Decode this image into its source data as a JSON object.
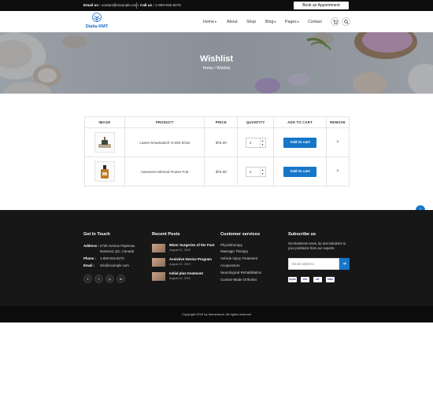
{
  "topbar": {
    "email_label": "Email us :",
    "email_value": "contact@example.com",
    "call_label": "Call us :",
    "call_value": "1-800-915-6270",
    "appointment_button": "Book an Appointment"
  },
  "header": {
    "logo_text": "Dialia RMT",
    "nav": {
      "home": "Home",
      "about": "About",
      "shop": "Shop",
      "blog": "Blog",
      "pages": "Pages",
      "contact": "Contact"
    },
    "icons": {
      "cart": "cart-icon",
      "search": "search-icon",
      "dropdown": "chevron-down-icon"
    }
  },
  "hero": {
    "title": "Wishlist",
    "breadcrumb_home": "Home",
    "breadcrumb_sep": "/",
    "breadcrumb_current": "Wishlist"
  },
  "wishlist": {
    "headers": [
      "IMAGE",
      "PRODUCT",
      "PRICE",
      "QUANTITY",
      "ADD TO CART",
      "REMOVE"
    ],
    "rows": [
      {
        "product": "Latest Smartwatch H-250-2018",
        "price": "$75.00",
        "quantity": "1",
        "add_to_cart": "Add to cart",
        "remove": "×"
      },
      {
        "product": "Awesome Mineral Flower Fub",
        "price": "$75.00",
        "quantity": "1",
        "add_to_cart": "Add to cart",
        "remove": "×"
      }
    ]
  },
  "footer": {
    "get_in_touch": {
      "heading": "Get In Touch",
      "address_label": "Address :",
      "address_line1": "2726 Avenue Papineau",
      "address_line2": "Montreal, QC, Canada",
      "phone_label": "Phone :",
      "phone_value": "1-800-915-6270",
      "email_label": "Email :",
      "email_value": "info@example.com",
      "social": [
        "twitter-icon",
        "facebook-icon",
        "pinterest-icon",
        "linkedin-icon"
      ]
    },
    "recent_posts": {
      "heading": "Recent Posts",
      "posts": [
        {
          "title": "Minor Surgeries of the Foot",
          "date": "August 01, 2019"
        },
        {
          "title": "Assistive Device Program",
          "date": "August 01, 2019"
        },
        {
          "title": "Initial plus treatment",
          "date": "August 01, 2019"
        }
      ]
    },
    "services": {
      "heading": "Customer services",
      "items": [
        "Physiotherapy",
        "Massage Therapy",
        "Vehicle Injury Treatment",
        "Acupuncture",
        "Neurological Rehabilitation",
        "Custom-Made Orthotics"
      ]
    },
    "subscribe": {
      "heading": "Subscribe us",
      "text": "Get Business news, tip and solutions to your problems from our experts.",
      "email_placeholder": "Email address",
      "payments": [
        "PayPal",
        "VISA",
        "MC",
        "AMEX"
      ]
    },
    "copyright": "Copyright 2019 by themerarch. All rights reserved"
  },
  "colors": {
    "accent": "#1676c8",
    "footer_bg": "#171717",
    "topbar_bg": "#0e0e0e"
  }
}
